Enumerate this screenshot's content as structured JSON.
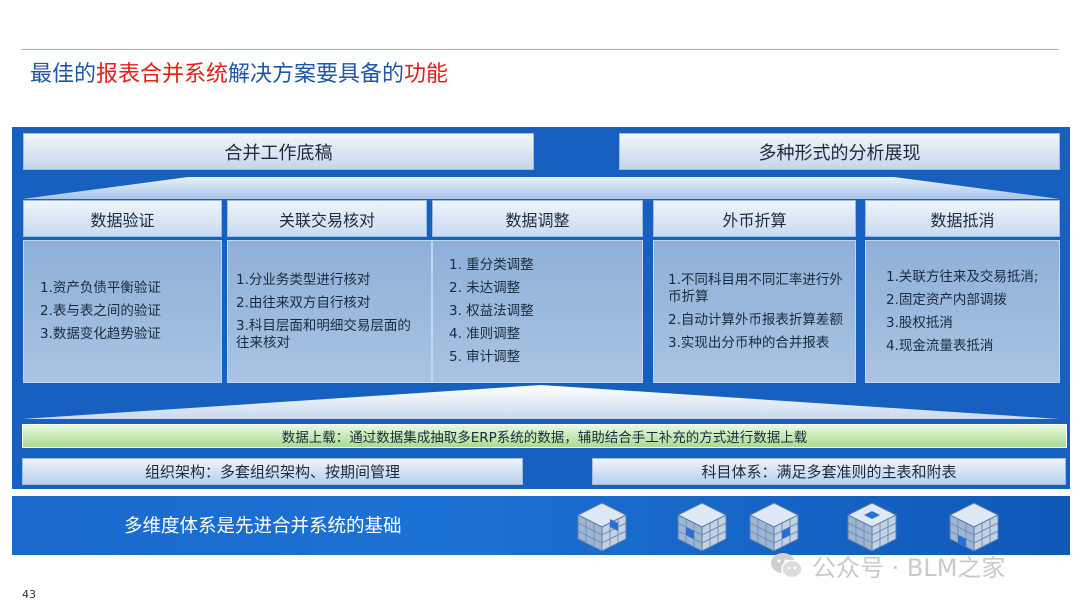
{
  "title": {
    "part1": "最佳的",
    "part2": "报表合并系统",
    "part3": "解决方案要具备的",
    "part4": "功能",
    "color_blue": "#1f57a8",
    "color_red": "#e0201b"
  },
  "headers": {
    "left": "合并工作底稿",
    "right": "多种形式的分析展现"
  },
  "columns": [
    {
      "title": "数据验证",
      "items": [
        "1.资产负债平衡验证",
        "2.表与表之间的验证",
        "3.数据变化趋势验证"
      ]
    },
    {
      "title": "关联交易核对",
      "items": [
        "1.分业务类型进行核对",
        "2.由往来双方自行核对",
        "3.科目层面和明细交易层面的往来核对"
      ]
    },
    {
      "title": "数据调整",
      "items": [
        "1. 重分类调整",
        "2. 未达调整",
        "3. 权益法调整",
        "4. 准则调整",
        "5. 审计调整"
      ]
    },
    {
      "title": "外币折算",
      "items": [
        "1.不同科目用不同汇率进行外币折算",
        "2.自动计算外币报表折算差额",
        "3.实现出分币种的合并报表"
      ]
    },
    {
      "title": "数据抵消",
      "items": [
        "1.关联方往来及交易抵消;",
        "2.固定资产内部调拨",
        "3.股权抵消",
        "4.现金流量表抵消"
      ]
    }
  ],
  "data_bar": "数据上载：通过数据集成抽取多ERP系统的数据，辅助结合手工补充的方式进行数据上载",
  "bottom_left": "组织架构：多套组织架构、按期间管理",
  "bottom_right": "科目体系：满足多套准则的主表和附表",
  "base_text": "多维度体系是先进合并系统的基础",
  "watermark": "公众号 · BLM之家",
  "page_number": "43",
  "colors": {
    "panel_blue": "#1760c0",
    "base_blue": "#1a69cc",
    "data_bar_green": "#a7dc92"
  },
  "icons": [
    "cube-grid-icon",
    "wechat-icon"
  ]
}
